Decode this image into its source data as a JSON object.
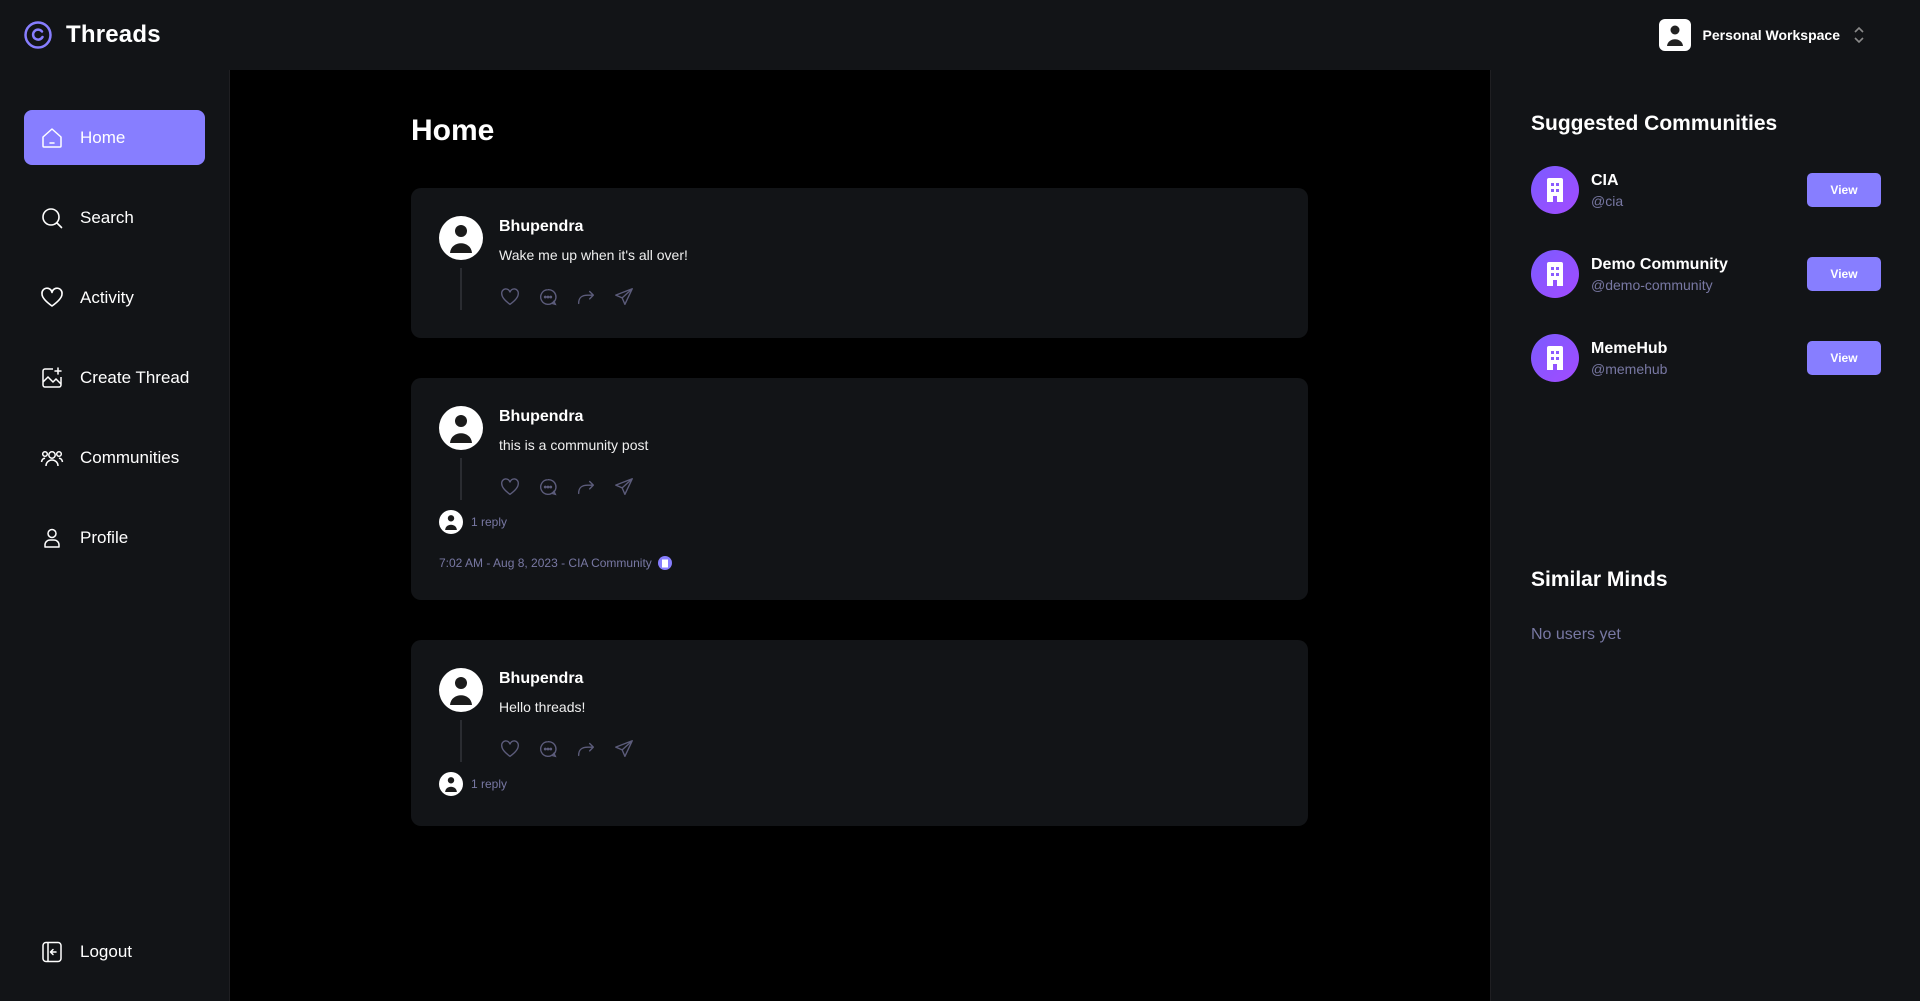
{
  "app": {
    "name": "Threads",
    "workspace": "Personal Workspace",
    "accent_color": "#877eff",
    "background_color": "#000000",
    "panel_color": "#121417",
    "muted_color": "#7878a3"
  },
  "sidebar": {
    "items": [
      {
        "label": "Home",
        "icon": "home-icon",
        "active": true
      },
      {
        "label": "Search",
        "icon": "search-icon",
        "active": false
      },
      {
        "label": "Activity",
        "icon": "heart-icon",
        "active": false
      },
      {
        "label": "Create Thread",
        "icon": "create-thread-icon",
        "active": false
      },
      {
        "label": "Communities",
        "icon": "communities-icon",
        "active": false
      },
      {
        "label": "Profile",
        "icon": "user-icon",
        "active": false
      }
    ],
    "logout": {
      "label": "Logout",
      "icon": "logout-icon"
    }
  },
  "main": {
    "title": "Home",
    "threads": [
      {
        "author": "Bhupendra",
        "text": "Wake me up when it's all over!",
        "reply": "",
        "meta": ""
      },
      {
        "author": "Bhupendra",
        "text": "this is a community post",
        "reply": "1 reply",
        "meta": "7:02 AM - Aug 8, 2023 - CIA Community"
      },
      {
        "author": "Bhupendra",
        "text": "Hello threads!",
        "reply": "1 reply",
        "meta": ""
      }
    ]
  },
  "rightbar": {
    "suggested_title": "Suggested Communities",
    "communities": [
      {
        "name": "CIA",
        "handle": "@cia",
        "button": "View"
      },
      {
        "name": "Demo Community",
        "handle": "@demo-community",
        "button": "View"
      },
      {
        "name": "MemeHub",
        "handle": "@memehub",
        "button": "View"
      }
    ],
    "similar_title": "Similar Minds",
    "similar_empty": "No users yet"
  }
}
